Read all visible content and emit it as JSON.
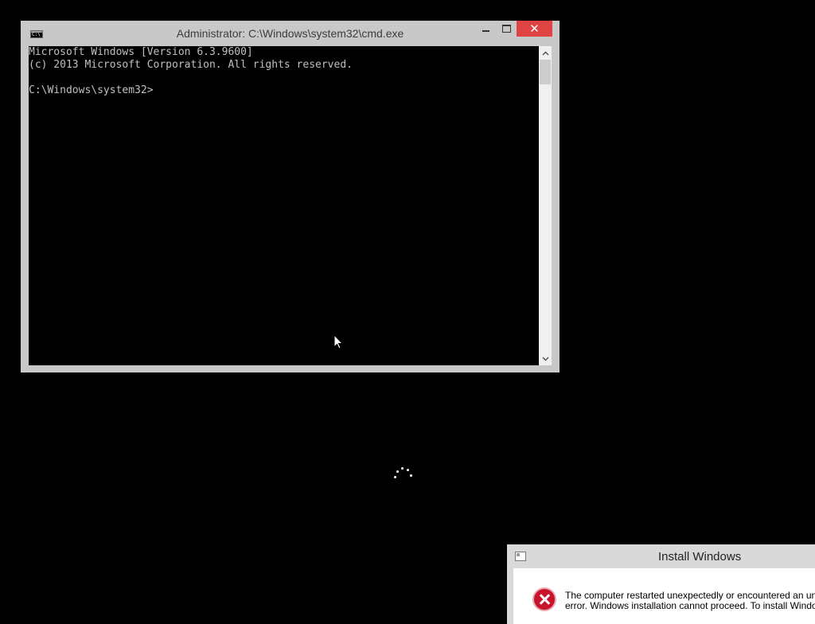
{
  "cmd_window": {
    "title": "Administrator: C:\\Windows\\system32\\cmd.exe",
    "buttons": {
      "minimize": "minimize",
      "maximize": "maximize",
      "close": "✕"
    },
    "console_lines": [
      "Microsoft Windows [Version 6.3.9600]",
      "(c) 2013 Microsoft Corporation. All rights reserved.",
      "",
      "C:\\Windows\\system32>"
    ],
    "scrollbar": {
      "up_icon": "chevron-up-icon",
      "down_icon": "chevron-down-icon"
    }
  },
  "install_dialog": {
    "title": "Install Windows",
    "message_lines": [
      "The computer restarted unexpectedly or encountered an un",
      "error. Windows installation cannot proceed. To install Windo"
    ],
    "icon": "error-icon",
    "colors": {
      "error": "#c8142b"
    }
  },
  "background_color": "#000000",
  "accent_close_color": "#e04343"
}
